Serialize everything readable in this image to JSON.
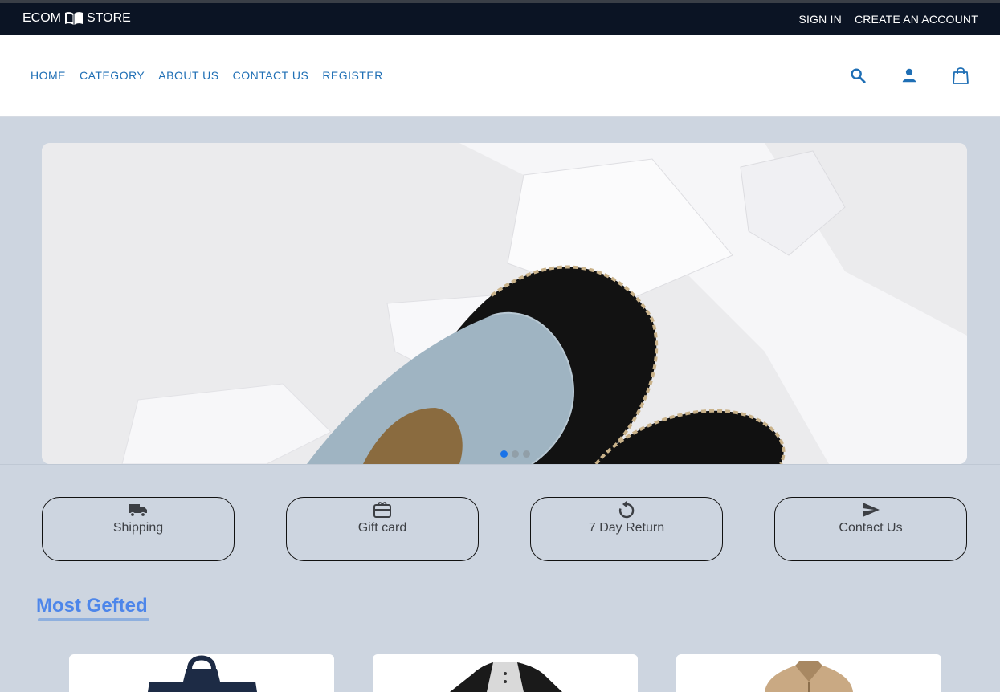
{
  "topbar": {
    "brand_left": "ECOM",
    "brand_right": "STORE",
    "brand_icon": "book-icon",
    "sign_in": "SIGN IN",
    "create_account": "CREATE AN ACCOUNT"
  },
  "nav": {
    "links": [
      "HOME",
      "CATEGORY",
      "ABOUT US",
      "CONTACT US",
      "REGISTER"
    ],
    "icons": [
      "search-icon",
      "account-icon",
      "shopping-bag-icon"
    ]
  },
  "carousel": {
    "slide_count": 3,
    "active_slide": 1
  },
  "features": [
    {
      "label": "Shipping",
      "icon": "truck-icon"
    },
    {
      "label": "Gift card",
      "icon": "gift-card-icon"
    },
    {
      "label": "7 Day Return",
      "icon": "return-icon"
    },
    {
      "label": "Contact Us",
      "icon": "send-icon"
    }
  ],
  "section": {
    "title": "Most Gefted"
  },
  "products": [
    {
      "icon": "bag-product-image"
    },
    {
      "icon": "shirt-product-image"
    },
    {
      "icon": "jacket-product-image"
    }
  ],
  "colors": {
    "topbar_bg": "#0b1424",
    "nav_link": "#1f6fb5",
    "page_bg": "#cdd5e0",
    "section_title": "#4d86ea",
    "active_dot": "#1a73e8"
  }
}
